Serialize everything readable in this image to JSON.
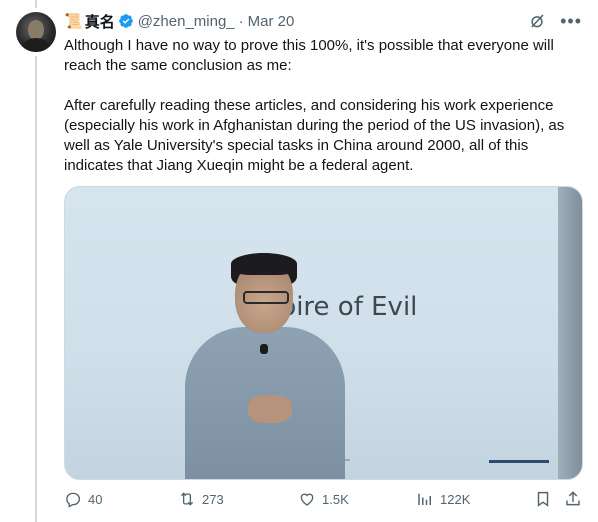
{
  "author": {
    "emoji": "📜",
    "display_name": "真名",
    "handle": "@zhen_ming_",
    "separator": "·",
    "date": "Mar 20"
  },
  "tweet": {
    "text": "Although I have no way to prove this 100%, it's possible that everyone will reach the same conclusion as me:\n\nAfter carefully reading these articles, and considering his work experience (especially his work in Afghanistan during the period of the US invasion), as well as Yale University's special tasks in China around 2000, all of this indicates that Jiang Xueqin might be a federal agent."
  },
  "media": {
    "slide_text": "E  pire of Evil"
  },
  "actions": {
    "replies": "40",
    "reposts": "273",
    "likes": "1.5K",
    "views": "122K"
  },
  "colors": {
    "secondary_text": "#536471",
    "verified_blue": "#1d9bf0",
    "border": "#cfd9de"
  },
  "icons": [
    "verified-badge-icon",
    "grok-icon",
    "more-icon",
    "reply-icon",
    "retweet-icon",
    "like-icon",
    "views-icon",
    "bookmark-icon",
    "share-icon"
  ]
}
